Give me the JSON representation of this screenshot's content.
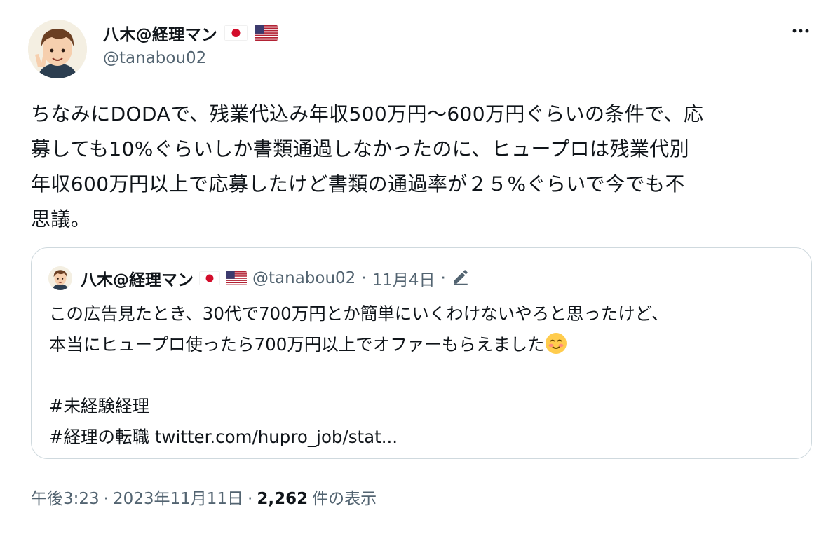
{
  "author": {
    "display_name": "八木@経理マン",
    "handle": "@tanabou02",
    "flags": [
      "japan-flag-icon",
      "usa-flag-icon"
    ]
  },
  "tweet": {
    "text": "ちなみにDODAで、残業代込み年収500万円～600万円ぐらいの条件で、応\n募しても10%ぐらいしか書類通過しなかったのに、ヒュープロは残業代別\n年収600万円以上で応募したけど書類の通過率が２５%ぐらいで今でも不\n思議。",
    "time": "午後3:23",
    "date": "2023年11月11日",
    "sep": "·",
    "views_count": "2,262",
    "views_label": "件の表示"
  },
  "quoted": {
    "display_name": "八木@経理マン",
    "handle": "@tanabou02",
    "date": "11月4日",
    "sep": "·",
    "line1": "この広告見たとき、30代で700万円とか簡単にいくわけないやろと思ったけど、",
    "line2": "本当にヒュープロ使ったら700万円以上でオファーもらえました",
    "hashtag1": "#未経験経理",
    "hashtag2": "#経理の転職",
    "link": "twitter.com/hupro_job/stat..."
  },
  "colors": {
    "text": "#0f1419",
    "secondary": "#536471",
    "border": "#cfd9de"
  }
}
